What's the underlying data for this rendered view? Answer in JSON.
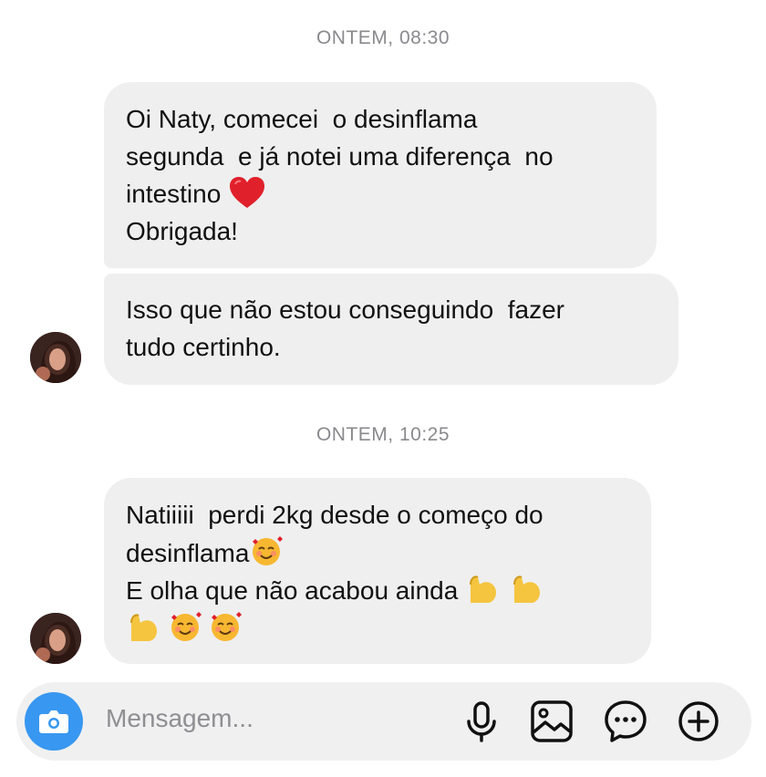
{
  "timestamps": [
    "ONTEM, 08:30",
    "ONTEM, 10:25"
  ],
  "messages": [
    {
      "lines": [
        "Oi Naty, comecei  o desinflama",
        "segunda  e já notei uma diferença  no",
        "intestino ",
        "Obrigada!"
      ],
      "emoji": [
        "red-heart"
      ]
    },
    {
      "lines": [
        "Isso que não estou conseguindo  fazer",
        "tudo certinho."
      ]
    },
    {
      "lines": [
        "Natiiiii  perdi 2kg desde o começo do",
        "desinflama",
        "E olha que não acabou ainda ",
        ""
      ],
      "emoji": [
        "smiling-face-with-hearts",
        "flexed-biceps",
        "flexed-biceps",
        "flexed-biceps",
        "smiling-face-with-hearts",
        "smiling-face-with-hearts"
      ]
    }
  ],
  "composer": {
    "placeholder": "Mensagem...",
    "icons": [
      "camera-icon",
      "microphone-icon",
      "gallery-icon",
      "sticker-icon",
      "plus-icon"
    ]
  },
  "colors": {
    "bubble": "#efefef",
    "timestamp": "#8a8a8e",
    "accent": "#3897f0"
  }
}
